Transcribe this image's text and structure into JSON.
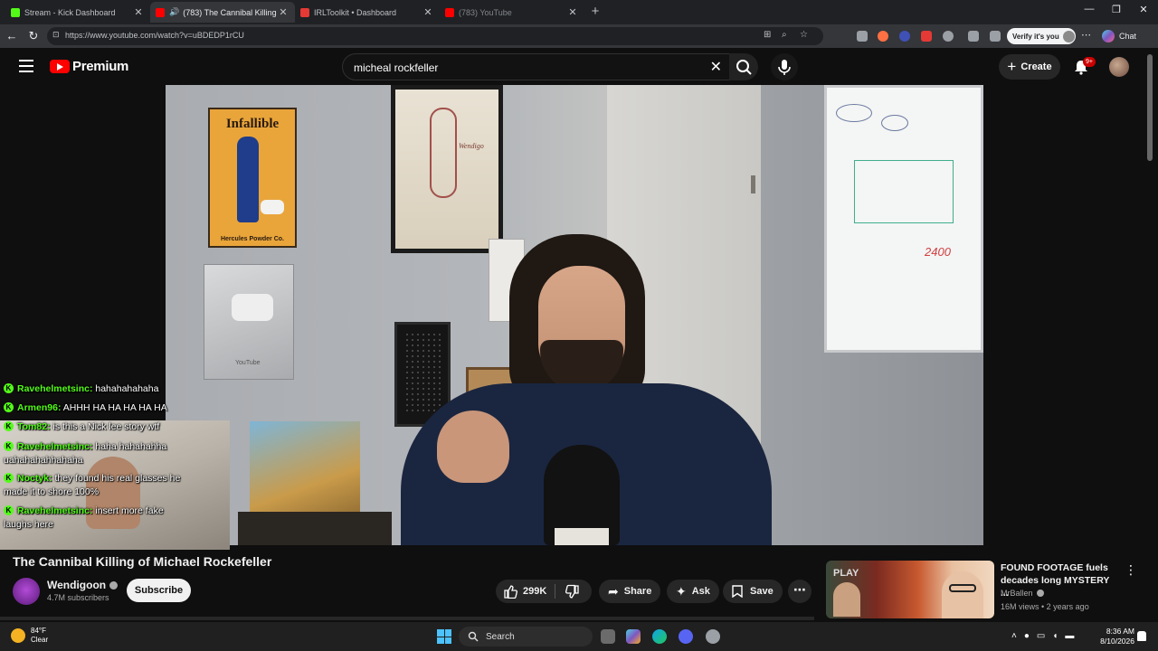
{
  "browser": {
    "tabs": [
      {
        "label": "Stream - Kick Dashboard",
        "color": "#53fc18",
        "active": false
      },
      {
        "label": "(783) The Cannibal Killing of M",
        "color": "#ff0000",
        "active": true
      },
      {
        "label": "IRLToolkit • Dashboard",
        "color": "#e53935",
        "active": false
      },
      {
        "label": "(783) YouTube",
        "color": "#ff0000",
        "active": false
      }
    ],
    "url": "https://www.youtube.com/watch?v=uBDEDP1rCU",
    "verify_label": "Verify it's you",
    "chat_label": "Chat"
  },
  "header": {
    "logo_text": "Premium",
    "search_query": "micheal rockfeller",
    "create_label": "Create",
    "notification_count": "9+"
  },
  "chat": [
    {
      "user": "Ravehelmetsinc:",
      "message": "hahahahahaha"
    },
    {
      "user": "Armen96:",
      "message": "AHHH HA HA HA HA HA"
    },
    {
      "user": "Tom82:",
      "message": "is this a Nick lee story wtf"
    },
    {
      "user": "Ravehelmetsinc:",
      "message": "haha hahahahha uahahahahhahaha"
    },
    {
      "user": "Noctyk:",
      "message": "they found his real glasses he made it to shore 100%"
    },
    {
      "user": "Ravehelmetsinc:",
      "message": "insert more fake laughs here"
    }
  ],
  "video": {
    "title": "The Cannibal Killing of Michael Rockefeller",
    "poster_title": "Infallible",
    "poster_caption": "Hercules Powder Co.",
    "artwork_label": "Wendigo",
    "whiteboard_number": "2400",
    "plaque_label": "YouTube"
  },
  "channel": {
    "name": "Wendigoon",
    "subscribers": "4.7M subscribers",
    "subscribe_label": "Subscribe"
  },
  "actions": {
    "likes": "299K",
    "share_label": "Share",
    "ask_label": "Ask",
    "save_label": "Save"
  },
  "recommendation": {
    "title": "FOUND FOOTAGE fuels decades long MYSTERY ...",
    "channel": "MrBallen",
    "meta": "16M views • 2 years ago",
    "thumb_label": "PLAY"
  },
  "taskbar": {
    "temperature": "84°F",
    "condition": "Clear",
    "search_label": "Search",
    "time": "8:36 AM",
    "date": "8/10/2026"
  }
}
